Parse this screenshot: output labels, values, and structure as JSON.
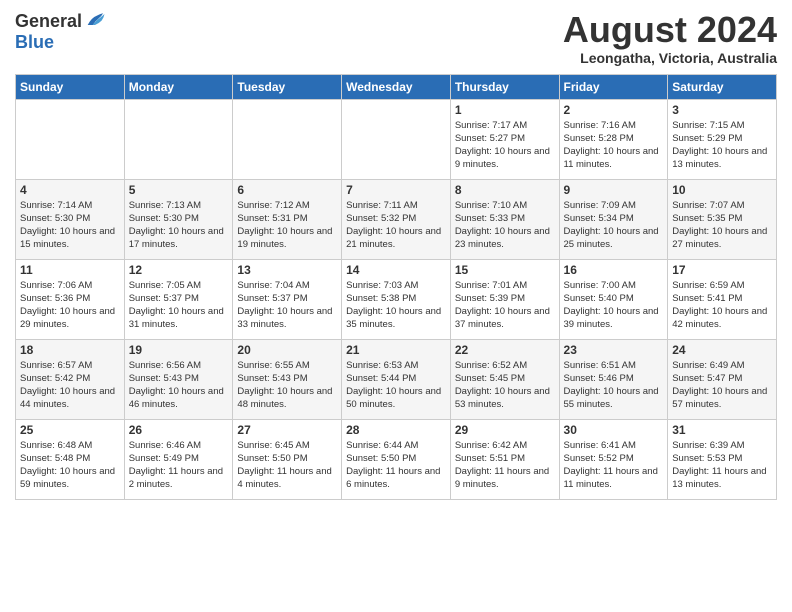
{
  "logo": {
    "general": "General",
    "blue": "Blue"
  },
  "title": "August 2024",
  "location": "Leongatha, Victoria, Australia",
  "headers": [
    "Sunday",
    "Monday",
    "Tuesday",
    "Wednesday",
    "Thursday",
    "Friday",
    "Saturday"
  ],
  "weeks": [
    [
      {
        "day": "",
        "sunrise": "",
        "sunset": "",
        "daylight": ""
      },
      {
        "day": "",
        "sunrise": "",
        "sunset": "",
        "daylight": ""
      },
      {
        "day": "",
        "sunrise": "",
        "sunset": "",
        "daylight": ""
      },
      {
        "day": "",
        "sunrise": "",
        "sunset": "",
        "daylight": ""
      },
      {
        "day": "1",
        "sunrise": "Sunrise: 7:17 AM",
        "sunset": "Sunset: 5:27 PM",
        "daylight": "Daylight: 10 hours and 9 minutes."
      },
      {
        "day": "2",
        "sunrise": "Sunrise: 7:16 AM",
        "sunset": "Sunset: 5:28 PM",
        "daylight": "Daylight: 10 hours and 11 minutes."
      },
      {
        "day": "3",
        "sunrise": "Sunrise: 7:15 AM",
        "sunset": "Sunset: 5:29 PM",
        "daylight": "Daylight: 10 hours and 13 minutes."
      }
    ],
    [
      {
        "day": "4",
        "sunrise": "Sunrise: 7:14 AM",
        "sunset": "Sunset: 5:30 PM",
        "daylight": "Daylight: 10 hours and 15 minutes."
      },
      {
        "day": "5",
        "sunrise": "Sunrise: 7:13 AM",
        "sunset": "Sunset: 5:30 PM",
        "daylight": "Daylight: 10 hours and 17 minutes."
      },
      {
        "day": "6",
        "sunrise": "Sunrise: 7:12 AM",
        "sunset": "Sunset: 5:31 PM",
        "daylight": "Daylight: 10 hours and 19 minutes."
      },
      {
        "day": "7",
        "sunrise": "Sunrise: 7:11 AM",
        "sunset": "Sunset: 5:32 PM",
        "daylight": "Daylight: 10 hours and 21 minutes."
      },
      {
        "day": "8",
        "sunrise": "Sunrise: 7:10 AM",
        "sunset": "Sunset: 5:33 PM",
        "daylight": "Daylight: 10 hours and 23 minutes."
      },
      {
        "day": "9",
        "sunrise": "Sunrise: 7:09 AM",
        "sunset": "Sunset: 5:34 PM",
        "daylight": "Daylight: 10 hours and 25 minutes."
      },
      {
        "day": "10",
        "sunrise": "Sunrise: 7:07 AM",
        "sunset": "Sunset: 5:35 PM",
        "daylight": "Daylight: 10 hours and 27 minutes."
      }
    ],
    [
      {
        "day": "11",
        "sunrise": "Sunrise: 7:06 AM",
        "sunset": "Sunset: 5:36 PM",
        "daylight": "Daylight: 10 hours and 29 minutes."
      },
      {
        "day": "12",
        "sunrise": "Sunrise: 7:05 AM",
        "sunset": "Sunset: 5:37 PM",
        "daylight": "Daylight: 10 hours and 31 minutes."
      },
      {
        "day": "13",
        "sunrise": "Sunrise: 7:04 AM",
        "sunset": "Sunset: 5:37 PM",
        "daylight": "Daylight: 10 hours and 33 minutes."
      },
      {
        "day": "14",
        "sunrise": "Sunrise: 7:03 AM",
        "sunset": "Sunset: 5:38 PM",
        "daylight": "Daylight: 10 hours and 35 minutes."
      },
      {
        "day": "15",
        "sunrise": "Sunrise: 7:01 AM",
        "sunset": "Sunset: 5:39 PM",
        "daylight": "Daylight: 10 hours and 37 minutes."
      },
      {
        "day": "16",
        "sunrise": "Sunrise: 7:00 AM",
        "sunset": "Sunset: 5:40 PM",
        "daylight": "Daylight: 10 hours and 39 minutes."
      },
      {
        "day": "17",
        "sunrise": "Sunrise: 6:59 AM",
        "sunset": "Sunset: 5:41 PM",
        "daylight": "Daylight: 10 hours and 42 minutes."
      }
    ],
    [
      {
        "day": "18",
        "sunrise": "Sunrise: 6:57 AM",
        "sunset": "Sunset: 5:42 PM",
        "daylight": "Daylight: 10 hours and 44 minutes."
      },
      {
        "day": "19",
        "sunrise": "Sunrise: 6:56 AM",
        "sunset": "Sunset: 5:43 PM",
        "daylight": "Daylight: 10 hours and 46 minutes."
      },
      {
        "day": "20",
        "sunrise": "Sunrise: 6:55 AM",
        "sunset": "Sunset: 5:43 PM",
        "daylight": "Daylight: 10 hours and 48 minutes."
      },
      {
        "day": "21",
        "sunrise": "Sunrise: 6:53 AM",
        "sunset": "Sunset: 5:44 PM",
        "daylight": "Daylight: 10 hours and 50 minutes."
      },
      {
        "day": "22",
        "sunrise": "Sunrise: 6:52 AM",
        "sunset": "Sunset: 5:45 PM",
        "daylight": "Daylight: 10 hours and 53 minutes."
      },
      {
        "day": "23",
        "sunrise": "Sunrise: 6:51 AM",
        "sunset": "Sunset: 5:46 PM",
        "daylight": "Daylight: 10 hours and 55 minutes."
      },
      {
        "day": "24",
        "sunrise": "Sunrise: 6:49 AM",
        "sunset": "Sunset: 5:47 PM",
        "daylight": "Daylight: 10 hours and 57 minutes."
      }
    ],
    [
      {
        "day": "25",
        "sunrise": "Sunrise: 6:48 AM",
        "sunset": "Sunset: 5:48 PM",
        "daylight": "Daylight: 10 hours and 59 minutes."
      },
      {
        "day": "26",
        "sunrise": "Sunrise: 6:46 AM",
        "sunset": "Sunset: 5:49 PM",
        "daylight": "Daylight: 11 hours and 2 minutes."
      },
      {
        "day": "27",
        "sunrise": "Sunrise: 6:45 AM",
        "sunset": "Sunset: 5:50 PM",
        "daylight": "Daylight: 11 hours and 4 minutes."
      },
      {
        "day": "28",
        "sunrise": "Sunrise: 6:44 AM",
        "sunset": "Sunset: 5:50 PM",
        "daylight": "Daylight: 11 hours and 6 minutes."
      },
      {
        "day": "29",
        "sunrise": "Sunrise: 6:42 AM",
        "sunset": "Sunset: 5:51 PM",
        "daylight": "Daylight: 11 hours and 9 minutes."
      },
      {
        "day": "30",
        "sunrise": "Sunrise: 6:41 AM",
        "sunset": "Sunset: 5:52 PM",
        "daylight": "Daylight: 11 hours and 11 minutes."
      },
      {
        "day": "31",
        "sunrise": "Sunrise: 6:39 AM",
        "sunset": "Sunset: 5:53 PM",
        "daylight": "Daylight: 11 hours and 13 minutes."
      }
    ]
  ]
}
